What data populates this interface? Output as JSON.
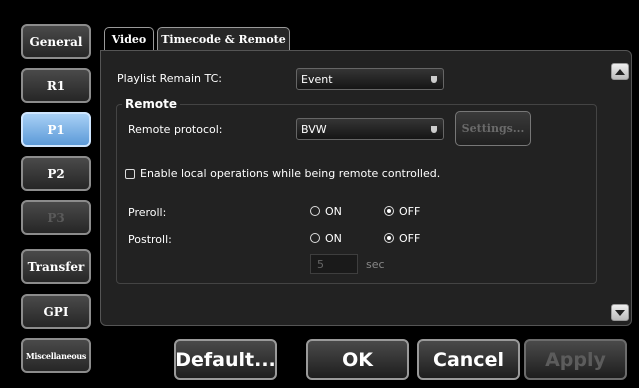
{
  "sidebar": {
    "items": [
      {
        "label": "General",
        "state": "normal"
      },
      {
        "label": "R1",
        "state": "normal"
      },
      {
        "label": "P1",
        "state": "active"
      },
      {
        "label": "P2",
        "state": "normal"
      },
      {
        "label": "P3",
        "state": "disabled"
      },
      {
        "label": "Transfer",
        "state": "normal"
      },
      {
        "label": "GPI",
        "state": "normal"
      },
      {
        "label": "Miscellaneous",
        "state": "normal"
      }
    ]
  },
  "tabs": [
    {
      "label": "Video",
      "active": false
    },
    {
      "label": "Timecode & Remote",
      "active": true
    }
  ],
  "panel": {
    "playlist_remain_label": "Playlist Remain TC:",
    "playlist_remain_value": "Event",
    "remote_group_title": "Remote",
    "remote_protocol_label": "Remote protocol:",
    "remote_protocol_value": "BVW",
    "settings_label": "Settings...",
    "enable_local_label": "Enable local operations while being remote controlled.",
    "enable_local_checked": false,
    "preroll_label": "Preroll:",
    "postroll_label": "Postroll:",
    "on_label": "ON",
    "off_label": "OFF",
    "preroll_value": "OFF",
    "postroll_value": "OFF",
    "sec_value": "5",
    "sec_unit": "sec"
  },
  "footer": {
    "default_label": "Default...",
    "ok_label": "OK",
    "cancel_label": "Cancel",
    "apply_label": "Apply",
    "apply_enabled": false
  },
  "colors": {
    "accent_active": "#7fb3e8",
    "background": "#000000",
    "panel": "#222222",
    "disabled_text": "#5a5a5a"
  },
  "icons": {
    "scroll_up": "triangle-up-icon",
    "scroll_down": "triangle-down-icon",
    "dropdown": "chevron-down-icon"
  }
}
